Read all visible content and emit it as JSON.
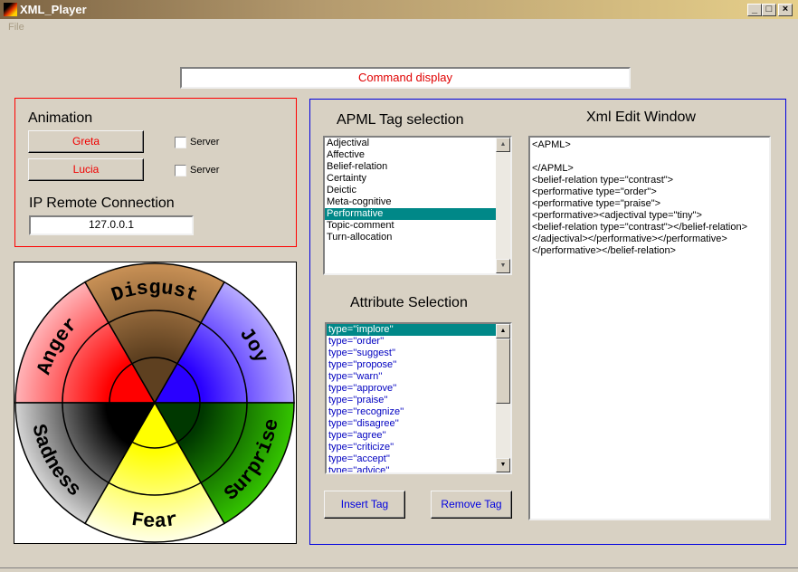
{
  "window": {
    "title": "XML_Player",
    "minimize": "_",
    "maximize": "□",
    "close": "×"
  },
  "menu": {
    "file": "File"
  },
  "command_display": "Command display",
  "animation": {
    "title": "Animation",
    "greta": "Greta",
    "lucia": "Lucia",
    "server1": "Server",
    "server2": "Server",
    "server1_checked": false,
    "server2_checked": false
  },
  "ip": {
    "title": "IP Remote Connection",
    "value": "127.0.0.1"
  },
  "wheel": {
    "segments": [
      {
        "label": "Anger",
        "inner": "#ff0000",
        "outer": "#ffb4b8"
      },
      {
        "label": "Disgust",
        "inner": "#5e4020",
        "outer": "#c99156"
      },
      {
        "label": "Joy",
        "inner": "#2a00ff",
        "outer": "#b8acff"
      },
      {
        "label": "Surprise",
        "inner": "#003800",
        "outer": "#34c400"
      },
      {
        "label": "Fear",
        "inner": "#ffff00",
        "outer": "#ffffe8"
      },
      {
        "label": "Sadness",
        "inner": "#000000",
        "outer": "#d4d4d4"
      }
    ]
  },
  "apml": {
    "title": "APML Tag selection",
    "items": [
      "Adjectival",
      "Affective",
      "Belief-relation",
      "Certainty",
      "Deictic",
      "Meta-cognitive",
      "Performative",
      "Topic-comment",
      "Turn-allocation"
    ],
    "selected": "Performative"
  },
  "attributes": {
    "title": "Attribute Selection",
    "items": [
      "type=''implore''",
      "type=''order''",
      "type=''suggest''",
      "type=''propose''",
      "type=''warn''",
      "type=''approve''",
      "type=''praise''",
      "type=''recognize''",
      "type=''disagree''",
      "type=''agree''",
      "type=''criticize''",
      "type=''accept''",
      "type=''advice''"
    ],
    "selected": "type=''implore''"
  },
  "buttons": {
    "insert": "Insert Tag",
    "remove": "Remove Tag"
  },
  "xml_editor": {
    "title": "Xml Edit Window",
    "content": "<APML>\n\n</APML>\n<belief-relation type=\"contrast\">\n<performative type=\"order\">\n<performative type=\"praise\">\n<performative><adjectival type=\"tiny\">\n<belief-relation type=\"contrast\"></belief-relation>\n</adjectival></performative></performative>\n</performative></belief-relation>"
  }
}
